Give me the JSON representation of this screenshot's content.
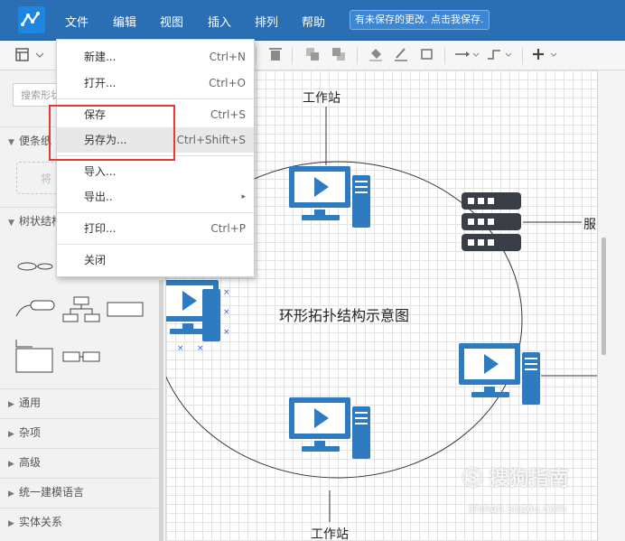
{
  "menubar": {
    "items": [
      "文件",
      "编辑",
      "视图",
      "插入",
      "排列",
      "帮助"
    ],
    "save_notice": "有未保存的更改. 点击我保存."
  },
  "sidebar": {
    "search_placeholder": "搜索形状",
    "sections": {
      "sticky": "便条纸",
      "drop_hint": "将",
      "tree": "树状结构",
      "general": "通用",
      "misc": "杂项",
      "advanced": "高级",
      "uml": "统一建模语言",
      "er": "实体关系"
    }
  },
  "dropdown": {
    "items": [
      {
        "label": "新建...",
        "shortcut": "Ctrl+N"
      },
      {
        "label": "打开...",
        "shortcut": "Ctrl+O"
      },
      {
        "label": "保存",
        "shortcut": "Ctrl+S"
      },
      {
        "label": "另存为...",
        "shortcut": "Ctrl+Shift+S"
      },
      {
        "label": "导入...",
        "shortcut": ""
      },
      {
        "label": "导出..",
        "shortcut": "▸"
      },
      {
        "label": "打印...",
        "shortcut": "Ctrl+P"
      },
      {
        "label": "关闭",
        "shortcut": ""
      }
    ]
  },
  "canvas": {
    "title": "环形拓扑结构示意图",
    "top_label": "工作站",
    "bottom_label": "工作站",
    "server_label": "服务"
  },
  "colors": {
    "menubar": "#2a6fb4",
    "accent": "#2f7bbf",
    "server": "#3a3f47",
    "highlight": "#e53935"
  },
  "icons": [
    "logo-icon",
    "layout-icon",
    "delete-icon",
    "fill-icon",
    "line-color-icon",
    "shadow-icon",
    "connector-icon",
    "waypoint-icon",
    "plus-icon",
    "monitor-icon",
    "server-icon"
  ]
}
